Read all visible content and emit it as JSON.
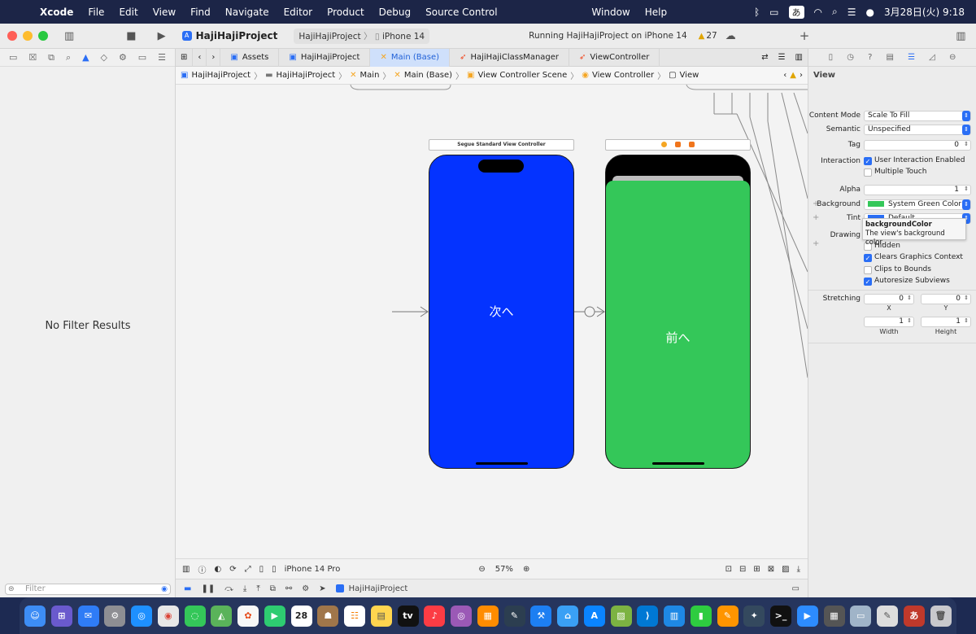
{
  "menubar": {
    "app": "Xcode",
    "items": [
      "File",
      "Edit",
      "View",
      "Find",
      "Navigate",
      "Editor",
      "Product",
      "Debug",
      "Source Control"
    ],
    "window": "Window",
    "help": "Help",
    "ime": "あ",
    "clock": "3月28日(火) 9:18"
  },
  "toolbar": {
    "project": "HajiHajiProject",
    "scheme_project": "HajiHajiProject",
    "scheme_device": "iPhone 14",
    "status": "Running HajiHajiProject on iPhone 14",
    "warnings": "27"
  },
  "navigator": {
    "empty_message": "No Filter Results",
    "filter_placeholder": "Filter"
  },
  "tabs": [
    {
      "label": "Assets"
    },
    {
      "label": "HajiHajiProject"
    },
    {
      "label": "Main (Base)"
    },
    {
      "label": "HajiHajiClassManager"
    },
    {
      "label": "ViewController"
    }
  ],
  "jumpbar": [
    "HajiHajiProject",
    "HajiHajiProject",
    "Main",
    "Main (Base)",
    "View Controller Scene",
    "View Controller",
    "View"
  ],
  "canvas": {
    "scene1_title": "Segue Standard View Controller",
    "scene1_label": "次へ",
    "scene2_label": "前へ",
    "blue_color": "#0433ff",
    "green_color": "#34c759"
  },
  "canvas_bottom": {
    "device": "iPhone 14 Pro",
    "zoom": "57%"
  },
  "debugbar": {
    "target": "HajiHajiProject"
  },
  "inspector": {
    "section": "View",
    "content_mode_label": "Content Mode",
    "content_mode": "Scale To Fill",
    "semantic_label": "Semantic",
    "semantic": "Unspecified",
    "tag_label": "Tag",
    "tag": "0",
    "interaction_label": "Interaction",
    "user_interaction": "User Interaction Enabled",
    "multiple_touch": "Multiple Touch",
    "alpha_label": "Alpha",
    "alpha": "1",
    "background_label": "Background",
    "background": "System Green Color",
    "tint_label": "Tint",
    "tint": "Default",
    "drawing_label": "Drawing",
    "hidden": "Hidden",
    "clears_graphics": "Clears Graphics Context",
    "clips_to_bounds": "Clips to Bounds",
    "autoresize": "Autoresize Subviews",
    "stretching_label": "Stretching",
    "stretch_x": "0",
    "stretch_y": "0",
    "stretch_w": "1",
    "stretch_h": "1",
    "x_label": "X",
    "y_label": "Y",
    "width_label": "Width",
    "height_label": "Height",
    "tooltip_title": "backgroundColor",
    "tooltip_body": "The view's background color."
  },
  "dock": {
    "calendar_day": "28",
    "appletv": "tv"
  }
}
